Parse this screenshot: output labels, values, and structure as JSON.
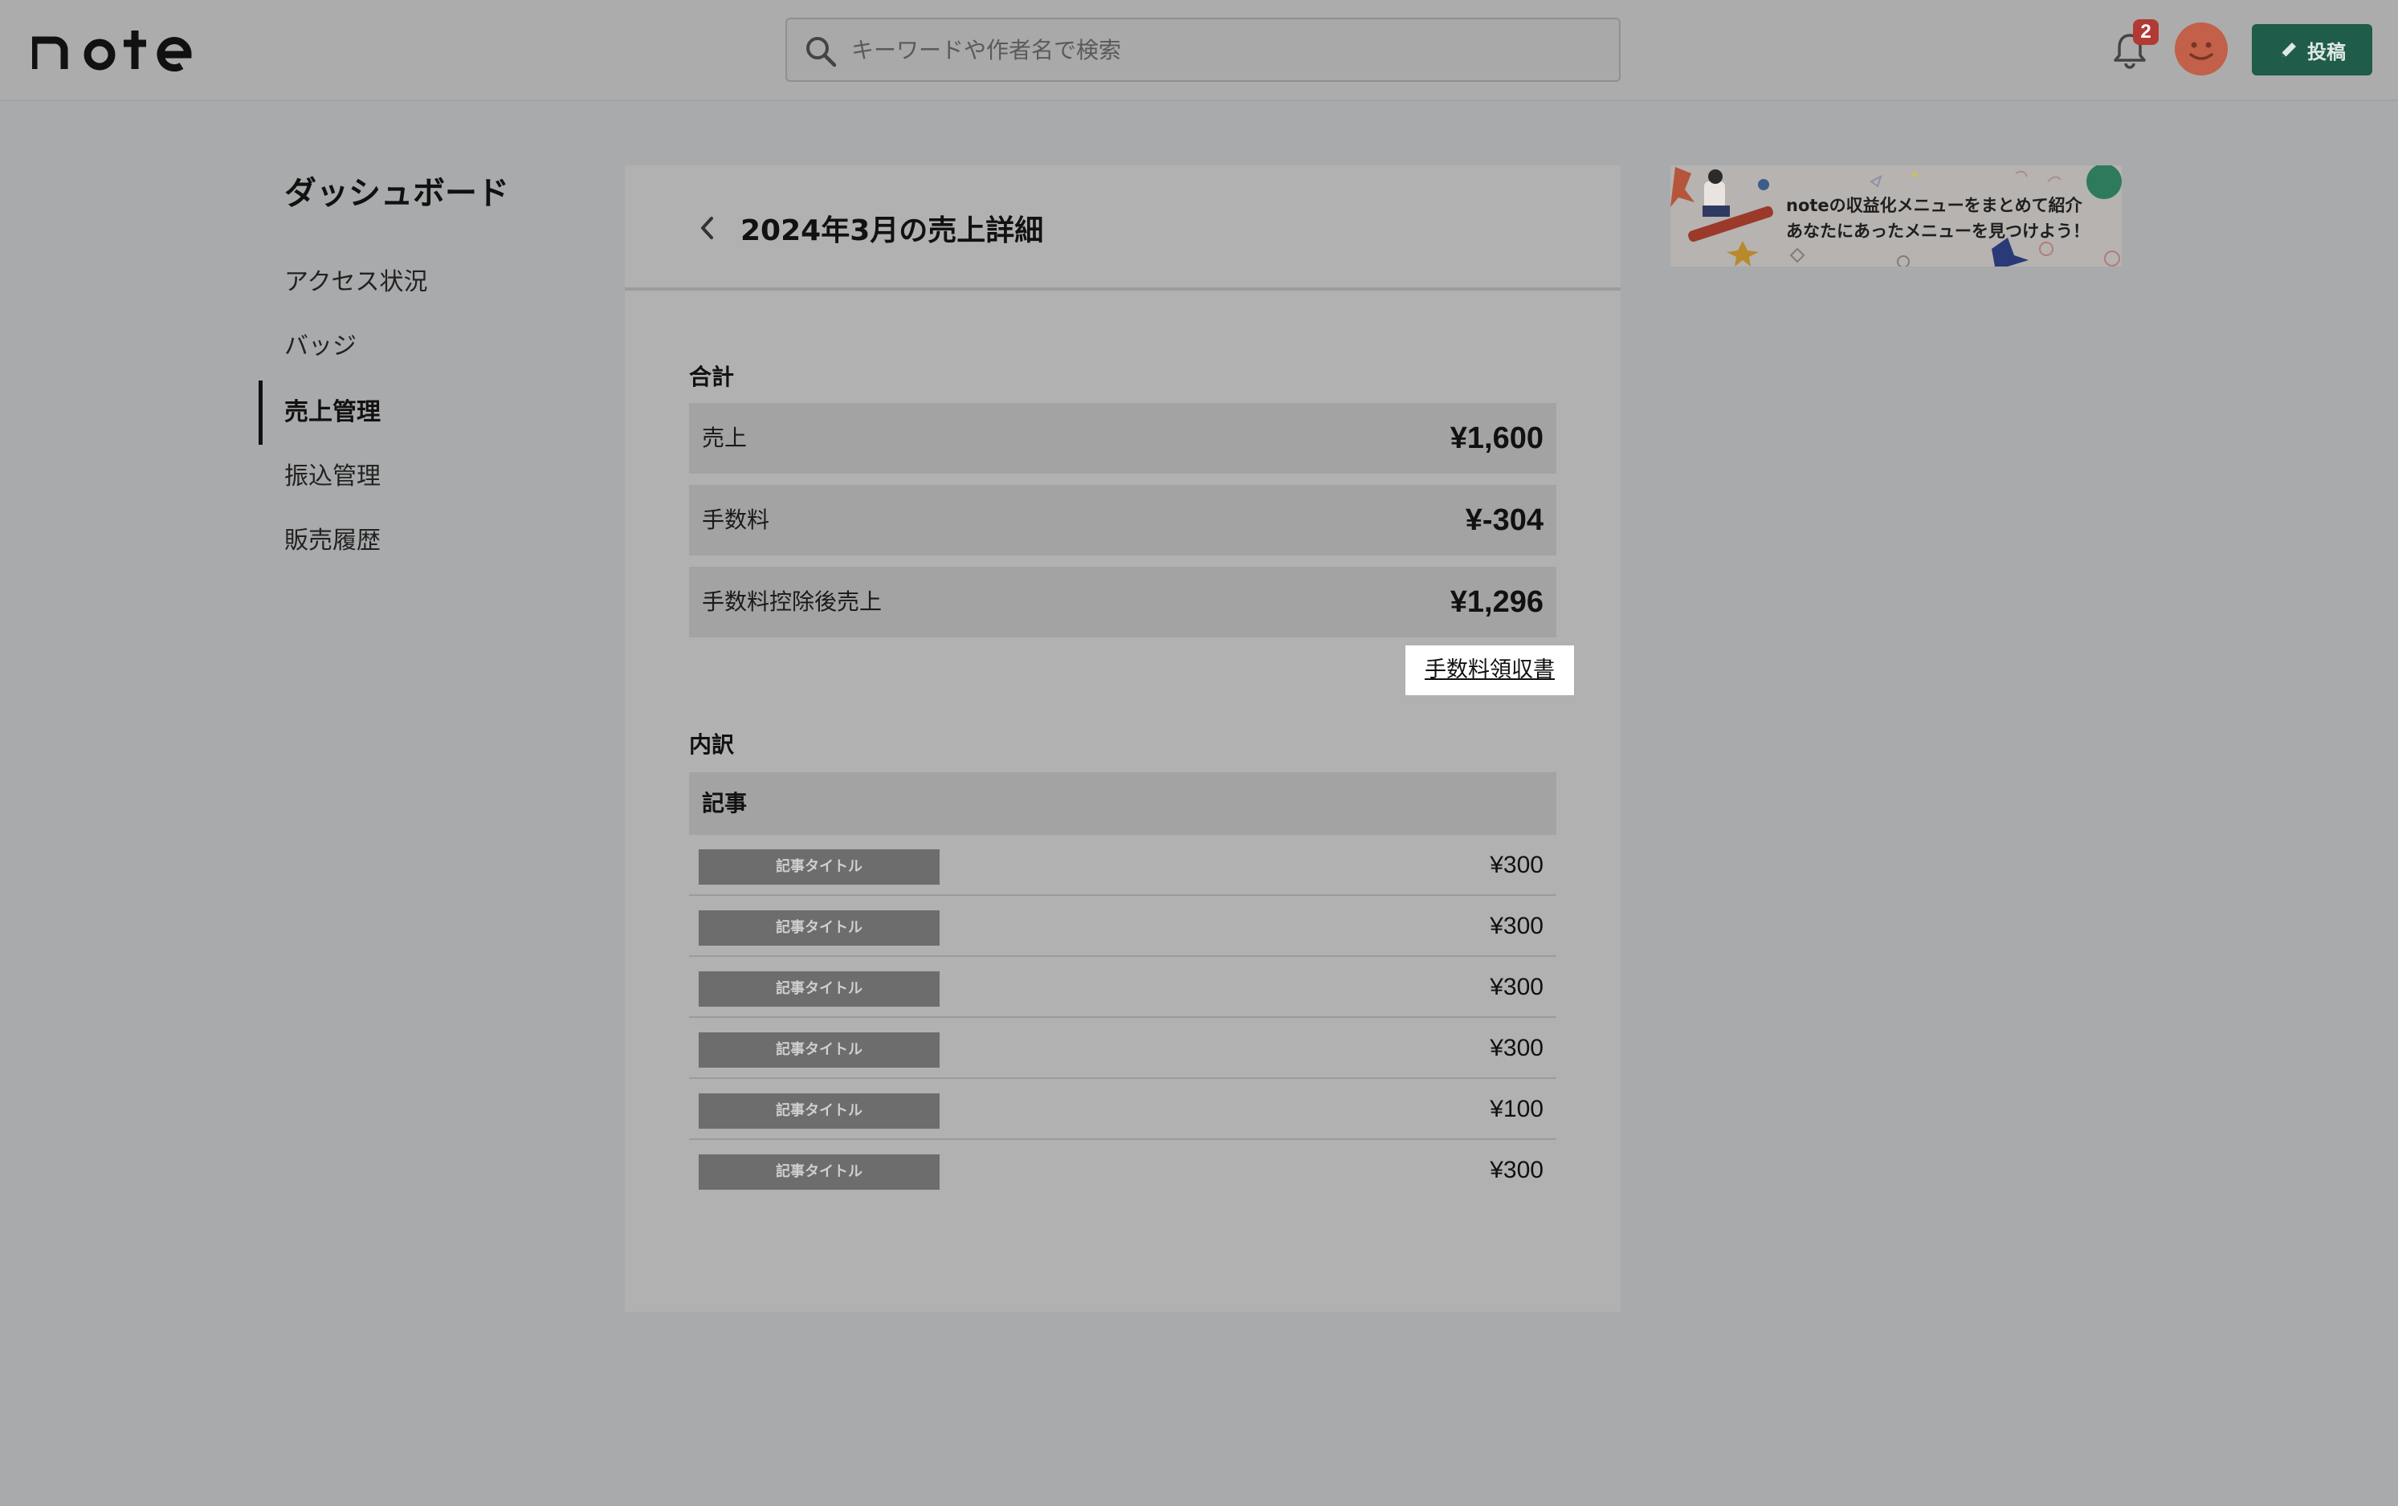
{
  "header": {
    "logo_text": "note",
    "search": {
      "placeholder": "キーワードや作者名で検索"
    },
    "notifications": {
      "count": "2"
    },
    "post_button_label": "投稿"
  },
  "sidebar": {
    "title": "ダッシュボード",
    "items": [
      {
        "label": "アクセス状況",
        "active": false
      },
      {
        "label": "バッジ",
        "active": false
      },
      {
        "label": "売上管理",
        "active": true
      },
      {
        "label": "振込管理",
        "active": false
      },
      {
        "label": "販売履歴",
        "active": false
      }
    ]
  },
  "main": {
    "title": "2024年3月の売上詳細",
    "total_section_label": "合計",
    "totals": [
      {
        "label": "売上",
        "value": "¥1,600"
      },
      {
        "label": "手数料",
        "value": "¥-304"
      },
      {
        "label": "手数料控除後売上",
        "value": "¥1,296"
      }
    ],
    "receipt_link_label": "手数料領収書",
    "breakdown_section_label": "内訳",
    "breakdown_category": "記事",
    "items": [
      {
        "title": "記事タイトル",
        "price": "¥300"
      },
      {
        "title": "記事タイトル",
        "price": "¥300"
      },
      {
        "title": "記事タイトル",
        "price": "¥300"
      },
      {
        "title": "記事タイトル",
        "price": "¥300"
      },
      {
        "title": "記事タイトル",
        "price": "¥100"
      },
      {
        "title": "記事タイトル",
        "price": "¥300"
      }
    ]
  },
  "banner": {
    "line1": "noteの収益化メニューをまとめて紹介",
    "line2": "あなたにあったメニューを見つけよう！"
  },
  "colors": {
    "overlay_background": "#a9aaab",
    "post_button": "#1f5c4a",
    "badge": "#b23a34",
    "avatar": "#c26049"
  }
}
